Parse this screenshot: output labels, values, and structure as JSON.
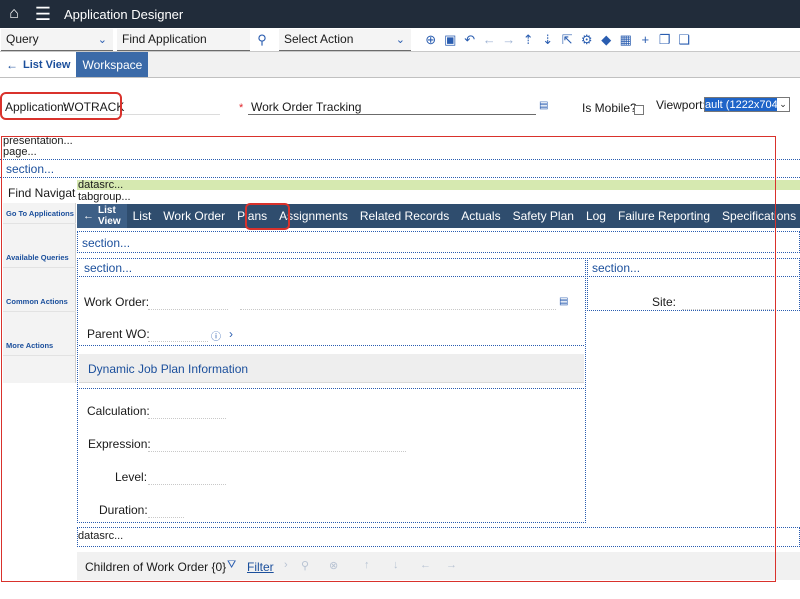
{
  "titlebar": {
    "title": "Application Designer",
    "home_icon": "home-icon",
    "menu_icon": "hamburger-menu-icon"
  },
  "toolbar": {
    "query_label": "Query",
    "find_app_label": "Find Application",
    "select_action_label": "Select Action"
  },
  "tabs": {
    "list_view": "List View",
    "workspace": "Workspace"
  },
  "header": {
    "application_label": "Application:",
    "application_value": "WOTRACK",
    "required_mark": "*",
    "description_value": "Work Order Tracking",
    "is_mobile_label": "Is Mobile?",
    "viewport_label": "Viewport:",
    "viewport_value": "ault (1222x704)"
  },
  "canvas": {
    "presentation": "presentation...",
    "page": "page...",
    "section_top": "section...",
    "datasrc_1": "datasrc...",
    "tabgroup": "tabgroup...",
    "section_under_tabs": "section...",
    "section_left": "section...",
    "section_right": "section...",
    "datasrc_2": "datasrc..."
  },
  "sidenav": {
    "find_navigation": "Find Navigati",
    "items": [
      "Go To Applications",
      "Available Queries",
      "Common Actions",
      "More Actions"
    ]
  },
  "inner_tabs": {
    "list_view": "List View",
    "tabs": [
      "List",
      "Work Order",
      "Plans",
      "Assignments",
      "Related Records",
      "Actuals",
      "Safety Plan",
      "Log",
      "Failure Reporting",
      "Specifications"
    ]
  },
  "fields": {
    "work_order": "Work Order:",
    "parent_wo": "Parent WO:",
    "site": "Site:",
    "dynamic_job_plan": "Dynamic Job Plan Information",
    "calculation": "Calculation:",
    "expression": "Expression:",
    "level": "Level:",
    "duration": "Duration:"
  },
  "children": {
    "title": "Children of Work Order {0}",
    "filter": "Filter"
  },
  "colors": {
    "accent": "#2a5db0",
    "highlight": "#d9322c",
    "titlebar": "#212c3a",
    "tabbar_dark": "#2f4d6e"
  }
}
